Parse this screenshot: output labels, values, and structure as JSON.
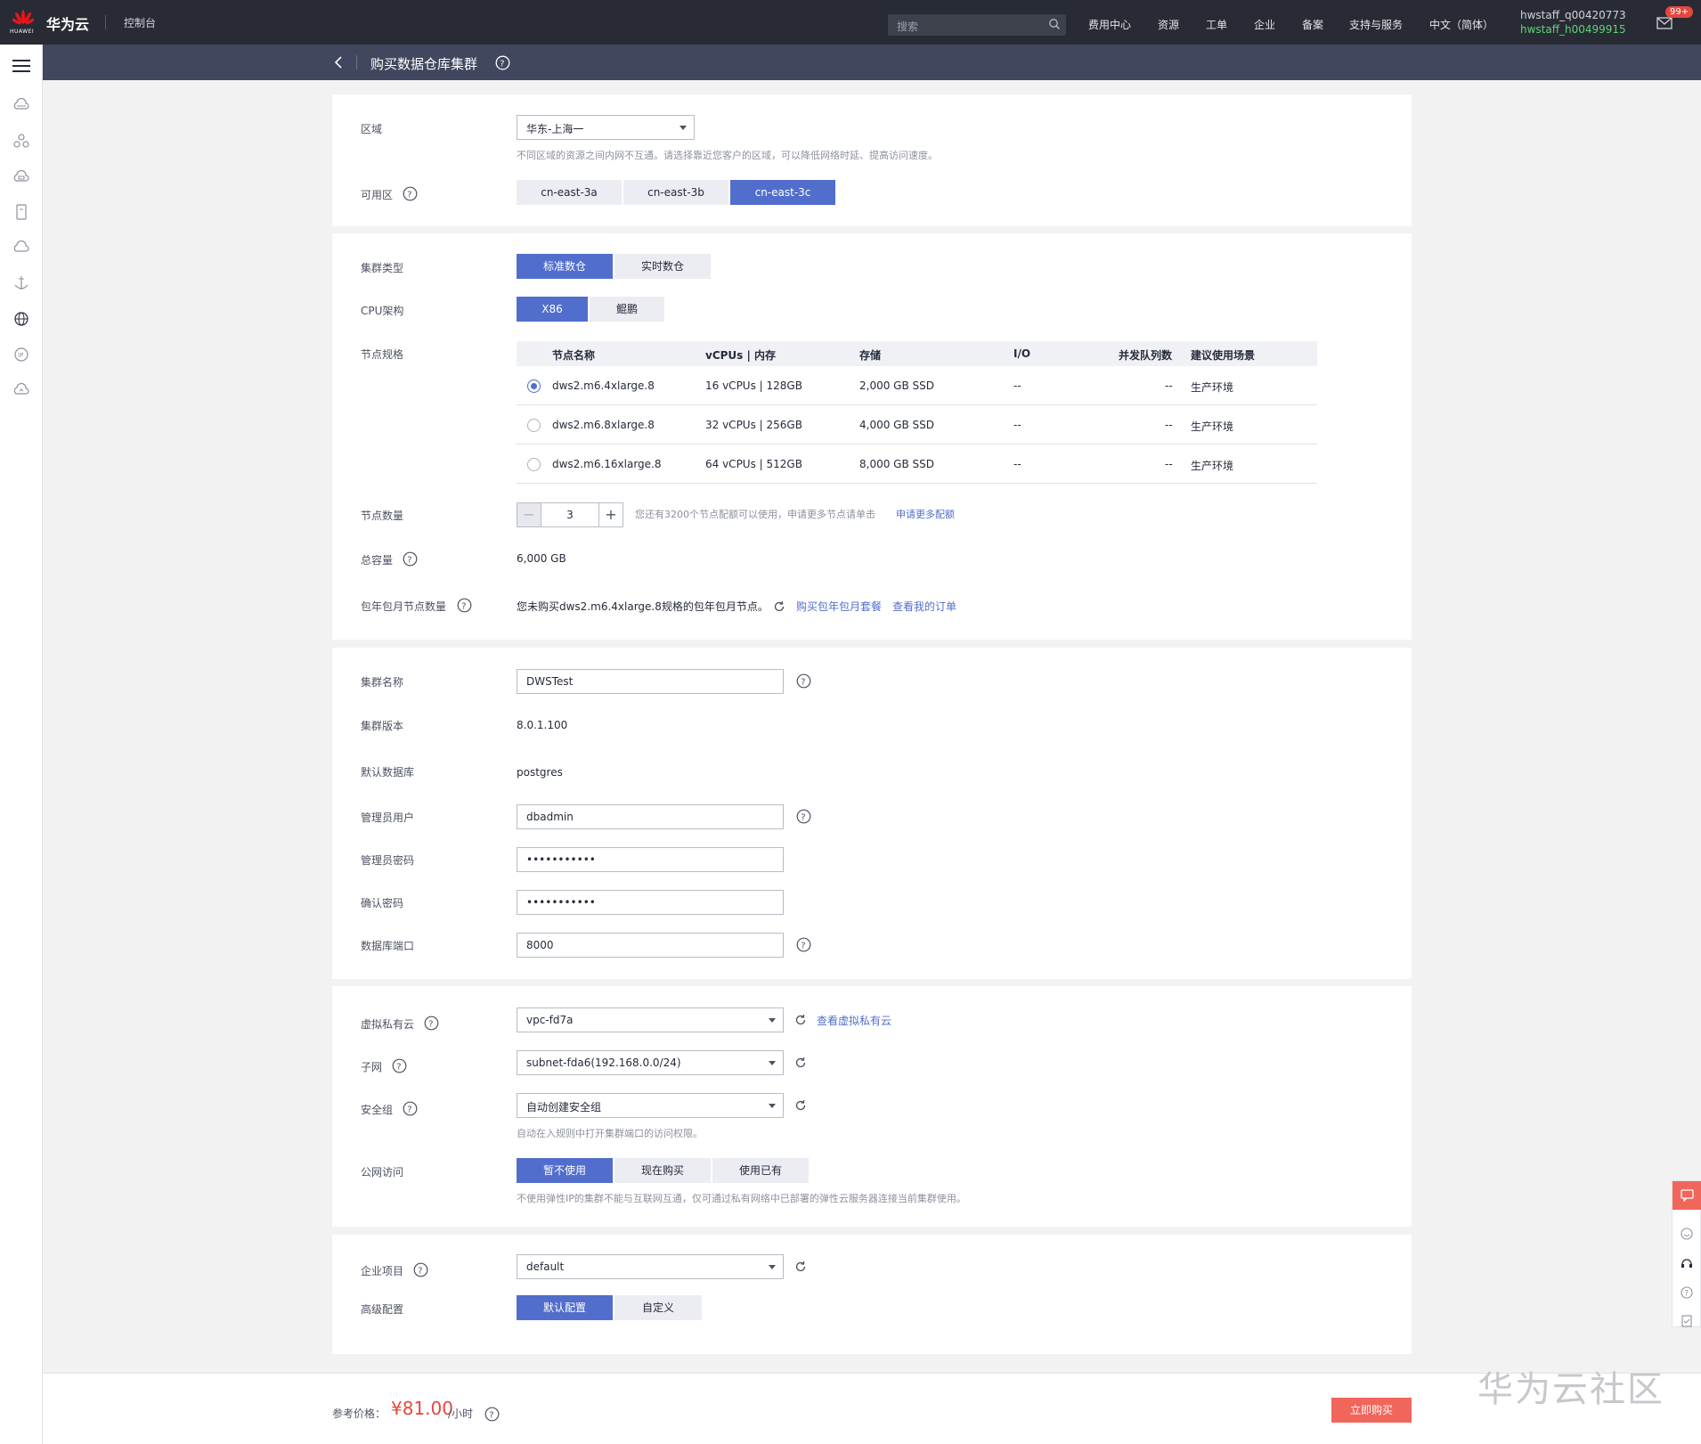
{
  "topbar": {
    "brand": "华为云",
    "logo_text": "HUAWEI",
    "console": "控制台",
    "search_placeholder": "搜索",
    "nav": [
      "费用中心",
      "资源",
      "工单",
      "企业",
      "备案",
      "支持与服务",
      "中文（简体）"
    ],
    "user_primary": "hwstaff_q00420773",
    "user_secondary": "hwstaff_h00499915",
    "badge": "99+"
  },
  "header": {
    "title": "购买数据仓库集群"
  },
  "region": {
    "label": "区域",
    "value": "华东-上海一",
    "hint": "不同区域的资源之间内网不互通。请选择靠近您客户的区域，可以降低网络时延、提高访问速度。",
    "az_label": "可用区",
    "azs": [
      "cn-east-3a",
      "cn-east-3b",
      "cn-east-3c"
    ],
    "az_selected": "cn-east-3c"
  },
  "cluster": {
    "type_label": "集群类型",
    "types": [
      "标准数仓",
      "实时数仓"
    ],
    "type_selected": "标准数仓",
    "cpu_label": "CPU架构",
    "cpus": [
      "X86",
      "鲲鹏"
    ],
    "cpu_selected": "X86",
    "spec_label": "节点规格",
    "columns": [
      "节点名称",
      "vCPUs | 内存",
      "存储",
      "I/O",
      "并发队列数",
      "建议使用场景"
    ],
    "rows": [
      {
        "name": "dws2.m6.4xlarge.8",
        "cpu_mem": "16 vCPUs | 128GB",
        "storage": "2,000 GB SSD",
        "io": "--",
        "queue": "--",
        "scene": "生产环境",
        "selected": true
      },
      {
        "name": "dws2.m6.8xlarge.8",
        "cpu_mem": "32 vCPUs | 256GB",
        "storage": "4,000 GB SSD",
        "io": "--",
        "queue": "--",
        "scene": "生产环境",
        "selected": false
      },
      {
        "name": "dws2.m6.16xlarge.8",
        "cpu_mem": "64 vCPUs | 512GB",
        "storage": "8,000 GB SSD",
        "io": "--",
        "queue": "--",
        "scene": "生产环境",
        "selected": false
      }
    ],
    "count_label": "节点数量",
    "count_value": "3",
    "count_hint": "您还有3200个节点配额可以使用，申请更多节点请单击",
    "count_link": "申请更多配额",
    "capacity_label": "总容量",
    "capacity_value": "6,000 GB",
    "monthly_label": "包年包月节点数量",
    "monthly_text": "您未购买dws2.m6.4xlarge.8规格的包年包月节点。",
    "monthly_link1": "购买包年包月套餐",
    "monthly_link2": "查看我的订单"
  },
  "basic": {
    "name_label": "集群名称",
    "name_value": "DWSTest",
    "version_label": "集群版本",
    "version_value": "8.0.1.100",
    "db_label": "默认数据库",
    "db_value": "postgres",
    "admin_label": "管理员用户",
    "admin_value": "dbadmin",
    "pwd_label": "管理员密码",
    "pwd_value": "•••••••••••",
    "confirm_label": "确认密码",
    "confirm_value": "•••••••••••",
    "port_label": "数据库端口",
    "port_value": "8000"
  },
  "network": {
    "vpc_label": "虚拟私有云",
    "vpc_value": "vpc-fd7a",
    "vpc_link": "查看虚拟私有云",
    "subnet_label": "子网",
    "subnet_value": "subnet-fda6(192.168.0.0/24)",
    "sg_label": "安全组",
    "sg_value": "自动创建安全组",
    "sg_hint": "自动在入规则中打开集群端口的访问权限。",
    "eip_label": "公网访问",
    "eip_options": [
      "暂不使用",
      "现在购买",
      "使用已有"
    ],
    "eip_selected": "暂不使用",
    "eip_hint": "不使用弹性IP的集群不能与互联网互通，仅可通过私有网络中已部署的弹性云服务器连接当前集群使用。"
  },
  "enterprise": {
    "project_label": "企业项目",
    "project_value": "default",
    "adv_label": "高级配置",
    "adv_options": [
      "默认配置",
      "自定义"
    ],
    "adv_selected": "默认配置"
  },
  "footer": {
    "price_label": "参考价格：",
    "price": "¥81.00",
    "price_unit": "/小时",
    "buy": "立即购买",
    "watermark": "华为云社区"
  },
  "colors": {
    "primary": "#526ecc",
    "topbar": "#282b33",
    "header": "#40475e",
    "danger": "#f1665b"
  }
}
